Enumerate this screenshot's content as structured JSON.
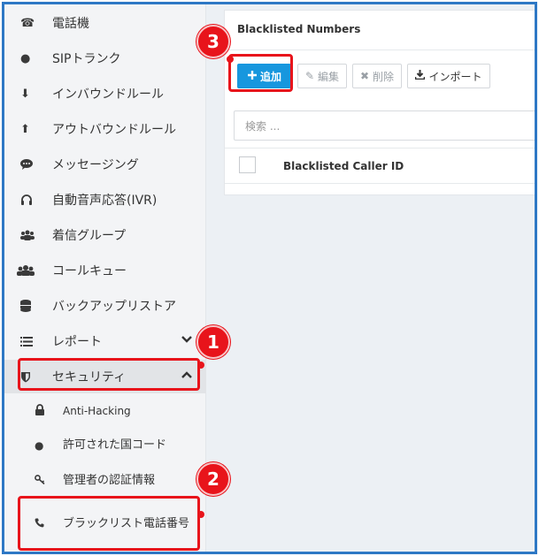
{
  "sidebar": {
    "items": [
      {
        "label": "電話機",
        "icon": "phone-desk-icon"
      },
      {
        "label": "SIPトランク",
        "icon": "globe-icon"
      },
      {
        "label": "インバウンドルール",
        "icon": "arrow-down-icon"
      },
      {
        "label": "アウトバウンドルール",
        "icon": "arrow-up-icon"
      },
      {
        "label": "メッセージング",
        "icon": "chat-icon"
      },
      {
        "label": "自動音声応答(IVR)",
        "icon": "headset-icon"
      },
      {
        "label": "着信グループ",
        "icon": "group-icon"
      },
      {
        "label": "コールキュー",
        "icon": "users-icon"
      },
      {
        "label": "バックアップリストア",
        "icon": "database-icon"
      },
      {
        "label": "レポート",
        "icon": "list-icon"
      },
      {
        "label": "セキュリティ",
        "icon": "shield-icon"
      }
    ],
    "security_sub": [
      {
        "label": "Anti-Hacking",
        "icon": "lock-icon"
      },
      {
        "label": "許可された国コード",
        "icon": "globe-icon"
      },
      {
        "label": "管理者の認証情報",
        "icon": "key-icon"
      },
      {
        "label": "ブラックリスト電話番号",
        "icon": "phone-icon"
      }
    ]
  },
  "panel": {
    "title": "Blacklisted Numbers",
    "buttons": {
      "add": "追加",
      "edit": "編集",
      "delete": "削除",
      "import": "インポート"
    },
    "search_placeholder": "検索 ...",
    "column_header": "Blacklisted Caller ID"
  },
  "annotations": [
    "1",
    "2",
    "3"
  ],
  "colors": {
    "accent": "#1797de",
    "annotation": "#e8141b",
    "frame": "#2e78c5"
  }
}
